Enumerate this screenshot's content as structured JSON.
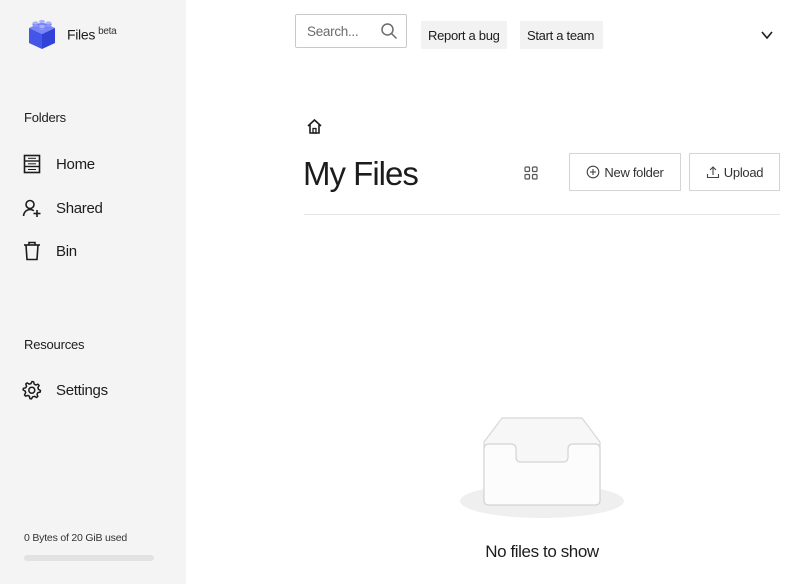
{
  "app": {
    "name": "Files",
    "badge": "beta",
    "logo_icon": "cube-logo-icon",
    "accent": "#4a5cf0"
  },
  "sidebar": {
    "folders_title": "Folders",
    "folders": [
      {
        "label": "Home",
        "icon": "home-list-icon"
      },
      {
        "label": "Shared",
        "icon": "shared-users-icon"
      },
      {
        "label": "Bin",
        "icon": "trash-icon"
      }
    ],
    "resources_title": "Resources",
    "resources": [
      {
        "label": "Settings",
        "icon": "gear-icon"
      }
    ],
    "usage": {
      "text": "0 Bytes of 20 GiB used",
      "fraction": 0
    }
  },
  "topbar": {
    "search": {
      "placeholder": "Search...",
      "value": "",
      "icon": "search-icon"
    },
    "report_bug_label": "Report a bug",
    "start_team_label": "Start a team",
    "menu_icon": "chevron-down-icon"
  },
  "main": {
    "breadcrumb_icon": "home-icon",
    "title": "My Files",
    "view_toggle_icon": "grid-view-icon",
    "new_folder_label": "New folder",
    "upload_label": "Upload",
    "empty_state": {
      "icon": "empty-inbox-icon",
      "message": "No files to show"
    }
  }
}
